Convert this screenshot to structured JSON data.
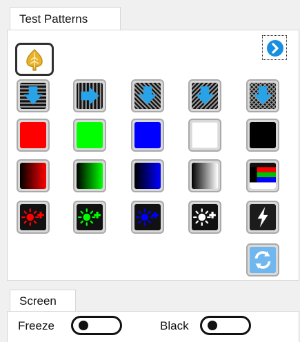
{
  "tabs": {
    "patterns_label": "Test Patterns",
    "screen_label": "Screen"
  },
  "toolbar": {
    "home_icon": "leaf-icon",
    "next_icon": "chevron-right-circle-icon",
    "next_color": "#1a8fe0"
  },
  "pattern_rows": [
    [
      {
        "name": "horizontal-lines-down",
        "icon": "horizontal-lines-down-arrow-icon"
      },
      {
        "name": "vertical-lines-right",
        "icon": "vertical-lines-right-arrow-icon"
      },
      {
        "name": "diagonal-lines-left",
        "icon": "diagonal-lines-down-arrow-icon"
      },
      {
        "name": "diagonal-lines-right",
        "icon": "diagonal-lines-down-arrow-icon"
      },
      {
        "name": "crosshatch",
        "icon": "crosshatch-down-arrow-icon"
      }
    ],
    [
      {
        "name": "solid-red",
        "color": "#ff0000"
      },
      {
        "name": "solid-green",
        "color": "#00ff00"
      },
      {
        "name": "solid-blue",
        "color": "#0000ff"
      },
      {
        "name": "solid-white",
        "color": "#ffffff"
      },
      {
        "name": "solid-black",
        "color": "#000000"
      }
    ],
    [
      {
        "name": "gradient-red",
        "from": "#000000",
        "to": "#ff0000"
      },
      {
        "name": "gradient-green",
        "from": "#000000",
        "to": "#00ff00"
      },
      {
        "name": "gradient-blue",
        "from": "#000000",
        "to": "#0000ff"
      },
      {
        "name": "gradient-gray",
        "from": "#000000",
        "to": "#ffffff"
      },
      {
        "name": "color-bars",
        "icon": "color-bars-icon"
      }
    ],
    [
      {
        "name": "brightness-red",
        "icon": "sun-plus-icon",
        "color": "#ff0000"
      },
      {
        "name": "brightness-green",
        "icon": "sun-plus-icon",
        "color": "#00ff00"
      },
      {
        "name": "brightness-blue",
        "icon": "sun-plus-icon",
        "color": "#0000ff"
      },
      {
        "name": "brightness-white",
        "icon": "sun-plus-icon",
        "color": "#ffffff"
      },
      {
        "name": "flash",
        "icon": "lightning-icon"
      }
    ]
  ],
  "refresh": {
    "icon": "refresh-icon",
    "color": "#1a8fe0"
  },
  "screen": {
    "freeze_label": "Freeze",
    "black_label": "Black",
    "freeze_on": false,
    "black_on": false
  }
}
